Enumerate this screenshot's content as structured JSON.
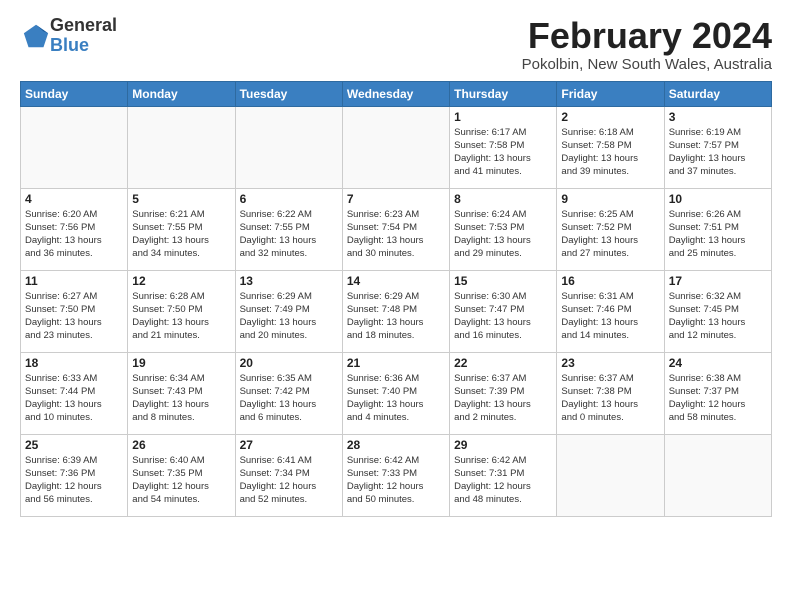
{
  "logo": {
    "general": "General",
    "blue": "Blue"
  },
  "title": "February 2024",
  "location": "Pokolbin, New South Wales, Australia",
  "days_of_week": [
    "Sunday",
    "Monday",
    "Tuesday",
    "Wednesday",
    "Thursday",
    "Friday",
    "Saturday"
  ],
  "weeks": [
    [
      {
        "day": "",
        "info": ""
      },
      {
        "day": "",
        "info": ""
      },
      {
        "day": "",
        "info": ""
      },
      {
        "day": "",
        "info": ""
      },
      {
        "day": "1",
        "info": "Sunrise: 6:17 AM\nSunset: 7:58 PM\nDaylight: 13 hours\nand 41 minutes."
      },
      {
        "day": "2",
        "info": "Sunrise: 6:18 AM\nSunset: 7:58 PM\nDaylight: 13 hours\nand 39 minutes."
      },
      {
        "day": "3",
        "info": "Sunrise: 6:19 AM\nSunset: 7:57 PM\nDaylight: 13 hours\nand 37 minutes."
      }
    ],
    [
      {
        "day": "4",
        "info": "Sunrise: 6:20 AM\nSunset: 7:56 PM\nDaylight: 13 hours\nand 36 minutes."
      },
      {
        "day": "5",
        "info": "Sunrise: 6:21 AM\nSunset: 7:55 PM\nDaylight: 13 hours\nand 34 minutes."
      },
      {
        "day": "6",
        "info": "Sunrise: 6:22 AM\nSunset: 7:55 PM\nDaylight: 13 hours\nand 32 minutes."
      },
      {
        "day": "7",
        "info": "Sunrise: 6:23 AM\nSunset: 7:54 PM\nDaylight: 13 hours\nand 30 minutes."
      },
      {
        "day": "8",
        "info": "Sunrise: 6:24 AM\nSunset: 7:53 PM\nDaylight: 13 hours\nand 29 minutes."
      },
      {
        "day": "9",
        "info": "Sunrise: 6:25 AM\nSunset: 7:52 PM\nDaylight: 13 hours\nand 27 minutes."
      },
      {
        "day": "10",
        "info": "Sunrise: 6:26 AM\nSunset: 7:51 PM\nDaylight: 13 hours\nand 25 minutes."
      }
    ],
    [
      {
        "day": "11",
        "info": "Sunrise: 6:27 AM\nSunset: 7:50 PM\nDaylight: 13 hours\nand 23 minutes."
      },
      {
        "day": "12",
        "info": "Sunrise: 6:28 AM\nSunset: 7:50 PM\nDaylight: 13 hours\nand 21 minutes."
      },
      {
        "day": "13",
        "info": "Sunrise: 6:29 AM\nSunset: 7:49 PM\nDaylight: 13 hours\nand 20 minutes."
      },
      {
        "day": "14",
        "info": "Sunrise: 6:29 AM\nSunset: 7:48 PM\nDaylight: 13 hours\nand 18 minutes."
      },
      {
        "day": "15",
        "info": "Sunrise: 6:30 AM\nSunset: 7:47 PM\nDaylight: 13 hours\nand 16 minutes."
      },
      {
        "day": "16",
        "info": "Sunrise: 6:31 AM\nSunset: 7:46 PM\nDaylight: 13 hours\nand 14 minutes."
      },
      {
        "day": "17",
        "info": "Sunrise: 6:32 AM\nSunset: 7:45 PM\nDaylight: 13 hours\nand 12 minutes."
      }
    ],
    [
      {
        "day": "18",
        "info": "Sunrise: 6:33 AM\nSunset: 7:44 PM\nDaylight: 13 hours\nand 10 minutes."
      },
      {
        "day": "19",
        "info": "Sunrise: 6:34 AM\nSunset: 7:43 PM\nDaylight: 13 hours\nand 8 minutes."
      },
      {
        "day": "20",
        "info": "Sunrise: 6:35 AM\nSunset: 7:42 PM\nDaylight: 13 hours\nand 6 minutes."
      },
      {
        "day": "21",
        "info": "Sunrise: 6:36 AM\nSunset: 7:40 PM\nDaylight: 13 hours\nand 4 minutes."
      },
      {
        "day": "22",
        "info": "Sunrise: 6:37 AM\nSunset: 7:39 PM\nDaylight: 13 hours\nand 2 minutes."
      },
      {
        "day": "23",
        "info": "Sunrise: 6:37 AM\nSunset: 7:38 PM\nDaylight: 13 hours\nand 0 minutes."
      },
      {
        "day": "24",
        "info": "Sunrise: 6:38 AM\nSunset: 7:37 PM\nDaylight: 12 hours\nand 58 minutes."
      }
    ],
    [
      {
        "day": "25",
        "info": "Sunrise: 6:39 AM\nSunset: 7:36 PM\nDaylight: 12 hours\nand 56 minutes."
      },
      {
        "day": "26",
        "info": "Sunrise: 6:40 AM\nSunset: 7:35 PM\nDaylight: 12 hours\nand 54 minutes."
      },
      {
        "day": "27",
        "info": "Sunrise: 6:41 AM\nSunset: 7:34 PM\nDaylight: 12 hours\nand 52 minutes."
      },
      {
        "day": "28",
        "info": "Sunrise: 6:42 AM\nSunset: 7:33 PM\nDaylight: 12 hours\nand 50 minutes."
      },
      {
        "day": "29",
        "info": "Sunrise: 6:42 AM\nSunset: 7:31 PM\nDaylight: 12 hours\nand 48 minutes."
      },
      {
        "day": "",
        "info": ""
      },
      {
        "day": "",
        "info": ""
      }
    ]
  ]
}
